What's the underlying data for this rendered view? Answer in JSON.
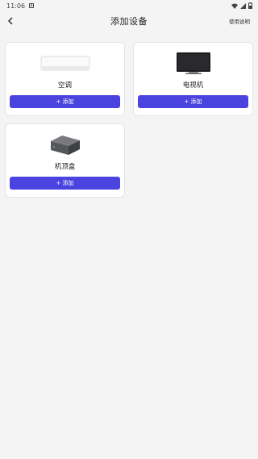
{
  "status_bar": {
    "time": "11:06",
    "notification_icon": "a-box-icon"
  },
  "header": {
    "title": "添加设备",
    "help_label": "使用说明",
    "back_icon": "chevron-left-icon"
  },
  "devices": [
    {
      "name": "空调",
      "add_label": "+ 添加",
      "image": "air-conditioner"
    },
    {
      "name": "电视机",
      "add_label": "+ 添加",
      "image": "television"
    },
    {
      "name": "机顶盒",
      "add_label": "+ 添加",
      "image": "set-top-box"
    }
  ],
  "colors": {
    "accent": "#4a43e0",
    "background": "#f4f4f5",
    "card": "#ffffff"
  }
}
